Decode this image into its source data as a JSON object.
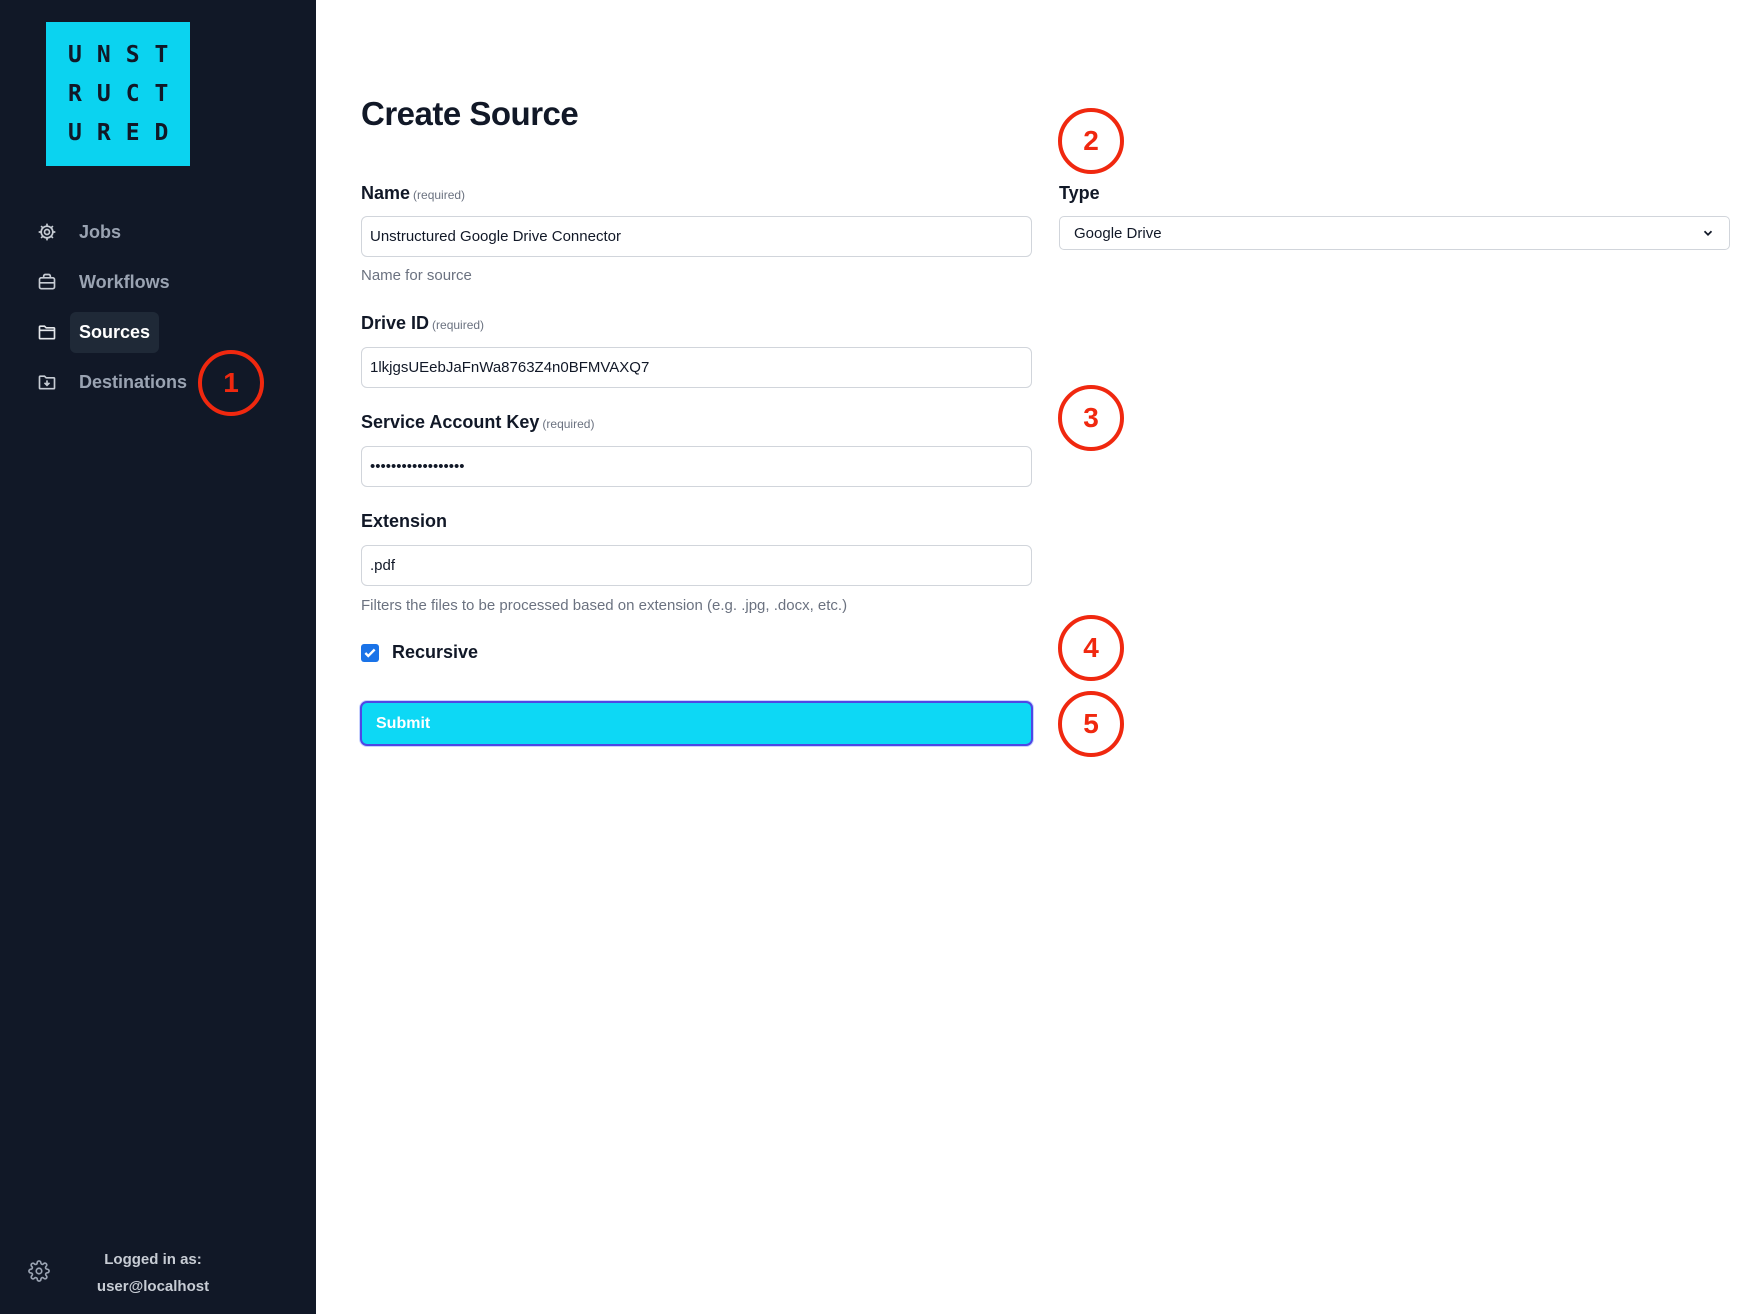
{
  "app": {
    "logo_lines": [
      "UNST",
      "RUCT",
      "URED"
    ]
  },
  "sidebar": {
    "items": [
      {
        "label": "Jobs",
        "icon": "gear-icon"
      },
      {
        "label": "Workflows",
        "icon": "briefcase-icon"
      },
      {
        "label": "Sources",
        "icon": "folder-icon",
        "active": true
      },
      {
        "label": "Destinations",
        "icon": "folder-download-icon"
      }
    ],
    "footer": {
      "logged_in_label": "Logged in as:",
      "user": "user@localhost",
      "icon": "settings-icon"
    }
  },
  "form": {
    "title": "Create Source",
    "name": {
      "label": "Name",
      "required": "(required)",
      "value": "Unstructured Google Drive Connector",
      "help": "Name for source"
    },
    "type": {
      "label": "Type",
      "value": "Google Drive"
    },
    "drive_id": {
      "label": "Drive ID",
      "required": "(required)",
      "value": "1lkjgsUEebJaFnWa8763Z4n0BFMVAXQ7"
    },
    "service_account_key": {
      "label": "Service Account Key",
      "required": "(required)",
      "value": "••••••••••••••••••"
    },
    "extension": {
      "label": "Extension",
      "value": ".pdf",
      "help": "Filters the files to be processed based on extension (e.g. .jpg, .docx, etc.)"
    },
    "recursive": {
      "label": "Recursive",
      "checked": true
    },
    "submit_label": "Submit"
  },
  "annotations": [
    "1",
    "2",
    "3",
    "4",
    "5"
  ],
  "colors": {
    "sidebar_bg": "#111827",
    "accent": "#0bd3f0",
    "annotation": "#f0280f",
    "checkbox": "#1a73e8",
    "focus_ring": "#4f46e5"
  }
}
